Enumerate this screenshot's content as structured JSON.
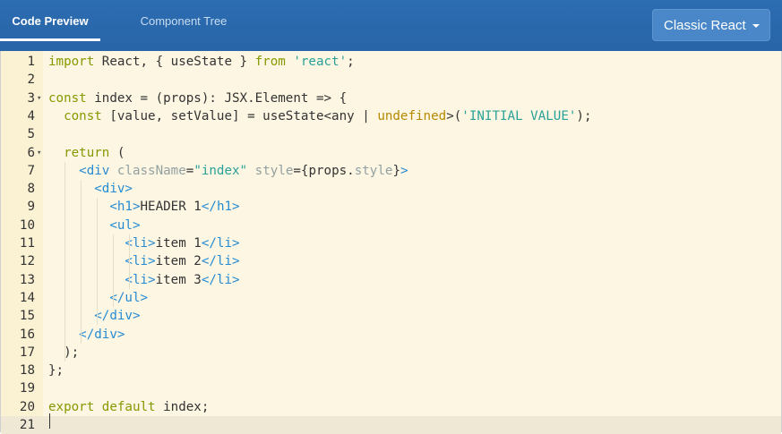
{
  "tabs": [
    {
      "label": "Code Preview",
      "active": true
    },
    {
      "label": "Component Tree",
      "active": false
    }
  ],
  "framework_select": {
    "selected": "Classic React"
  },
  "editor": {
    "active_line": 21,
    "lines": [
      {
        "num": "1",
        "text": "import React, { useState } from 'react';"
      },
      {
        "num": "2",
        "text": ""
      },
      {
        "num": "3",
        "text": "const index = (props): JSX.Element => {"
      },
      {
        "num": "4",
        "text": "  const [value, setValue] = useState<any | undefined>('INITIAL VALUE');"
      },
      {
        "num": "5",
        "text": ""
      },
      {
        "num": "6",
        "text": "  return ("
      },
      {
        "num": "7",
        "text": "    <div className=\"index\" style={props.style}>"
      },
      {
        "num": "8",
        "text": "      <div>"
      },
      {
        "num": "9",
        "text": "        <h1>HEADER 1</h1>"
      },
      {
        "num": "10",
        "text": "        <ul>"
      },
      {
        "num": "11",
        "text": "          <li>item 1</li>"
      },
      {
        "num": "12",
        "text": "          <li>item 2</li>"
      },
      {
        "num": "13",
        "text": "          <li>item 3</li>"
      },
      {
        "num": "14",
        "text": "        </ul>"
      },
      {
        "num": "15",
        "text": "      </div>"
      },
      {
        "num": "16",
        "text": "    </div>"
      },
      {
        "num": "17",
        "text": "  );"
      },
      {
        "num": "18",
        "text": "};"
      },
      {
        "num": "19",
        "text": ""
      },
      {
        "num": "20",
        "text": "export default index;"
      },
      {
        "num": "21",
        "text": ""
      }
    ]
  },
  "colors": {
    "header_bg": "#2c6cb1",
    "editor_bg": "#fdf6e3",
    "keyword": "#859900",
    "string": "#2aa198",
    "tag": "#268bd2"
  }
}
